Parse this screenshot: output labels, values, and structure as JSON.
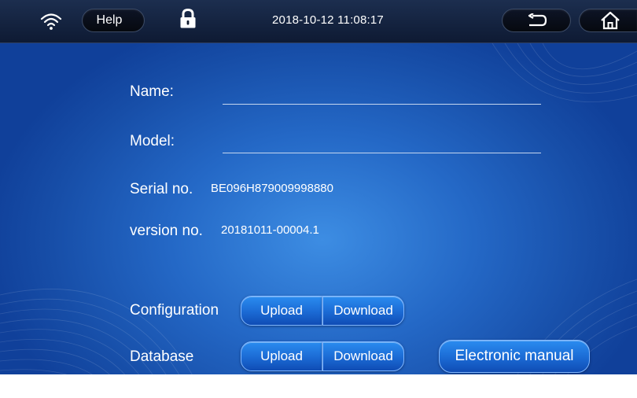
{
  "topbar": {
    "help_label": "Help",
    "datetime": "2018-10-12 11:08:17"
  },
  "form": {
    "name_label": "Name:",
    "name_value": "",
    "model_label": "Model:",
    "model_value": "",
    "serial_label": "Serial no.",
    "serial_value": "BE096H879009998880",
    "version_label": "version no.",
    "version_value": "20181011-00004.1"
  },
  "configuration": {
    "label": "Configuration",
    "upload_label": "Upload",
    "download_label": "Download"
  },
  "database": {
    "label": "Database",
    "upload_label": "Upload",
    "download_label": "Download"
  },
  "manual_label": "Electronic manual",
  "colors": {
    "accent": "#1b6ad4",
    "panel": "#2468c6",
    "topbar": "#0e1a33"
  }
}
